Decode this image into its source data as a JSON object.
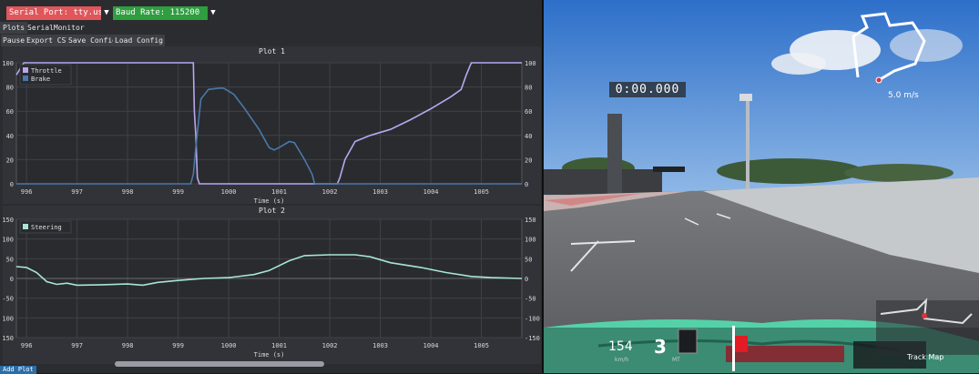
{
  "toolbar": {
    "serial_port_label": "Serial Port: tty.usbseria",
    "baud_rate_label": "Baud Rate: 115200",
    "tabs": [
      "Plots",
      "SerialMonitor"
    ],
    "buttons": [
      "Pause",
      "Export CSV",
      "Save Config",
      "Load Config"
    ],
    "add_plot": "Add Plot"
  },
  "colors": {
    "serial_port_bg": "#e0565b",
    "baud_rate_bg": "#2e9e3e",
    "throttle": "#b6a8f0",
    "brake": "#4a79a8",
    "steering": "#a8e6d2",
    "plot_bg": "#323338",
    "add_plot_bg": "#2a6fa8"
  },
  "chart_data": [
    {
      "type": "line",
      "title": "Plot 1",
      "xlabel": "Time (s)",
      "ylabel": "",
      "xlim": [
        995.8,
        1005.8
      ],
      "ylim": [
        0,
        100
      ],
      "x_ticks": [
        "996",
        "997",
        "998",
        "999",
        "1000",
        "1001",
        "1002",
        "1003",
        "1004",
        "1005"
      ],
      "y_ticks": [
        "0",
        "20",
        "40",
        "60",
        "80",
        "100"
      ],
      "legend_position": "top-left",
      "grid": true,
      "series": [
        {
          "name": "Throttle",
          "color_key": "throttle",
          "points": [
            [
              995.8,
              90
            ],
            [
              995.9,
              97
            ],
            [
              995.95,
              100
            ],
            [
              999.3,
              100
            ],
            [
              999.32,
              60
            ],
            [
              999.35,
              40
            ],
            [
              999.38,
              5
            ],
            [
              999.42,
              0
            ],
            [
              1002.15,
              0
            ],
            [
              1002.2,
              5
            ],
            [
              1002.3,
              20
            ],
            [
              1002.5,
              35
            ],
            [
              1002.8,
              40
            ],
            [
              1003.2,
              45
            ],
            [
              1003.6,
              53
            ],
            [
              1004.0,
              62
            ],
            [
              1004.4,
              72
            ],
            [
              1004.6,
              78
            ],
            [
              1004.7,
              90
            ],
            [
              1004.8,
              100
            ],
            [
              1005.8,
              100
            ]
          ]
        },
        {
          "name": "Brake",
          "color_key": "brake",
          "points": [
            [
              995.8,
              0
            ],
            [
              999.25,
              0
            ],
            [
              999.3,
              8
            ],
            [
              999.35,
              30
            ],
            [
              999.45,
              70
            ],
            [
              999.6,
              78
            ],
            [
              999.8,
              79
            ],
            [
              999.9,
              79
            ],
            [
              1000.1,
              74
            ],
            [
              1000.3,
              63
            ],
            [
              1000.6,
              45
            ],
            [
              1000.8,
              30
            ],
            [
              1000.9,
              28
            ],
            [
              1001.0,
              30
            ],
            [
              1001.2,
              35
            ],
            [
              1001.3,
              34
            ],
            [
              1001.5,
              20
            ],
            [
              1001.65,
              8
            ],
            [
              1001.7,
              0
            ],
            [
              1005.8,
              0
            ]
          ]
        }
      ]
    },
    {
      "type": "line",
      "title": "Plot 2",
      "xlabel": "Time (s)",
      "ylabel": "",
      "xlim": [
        995.8,
        1005.8
      ],
      "ylim": [
        -150,
        150
      ],
      "x_ticks": [
        "996",
        "997",
        "998",
        "999",
        "1000",
        "1001",
        "1002",
        "1003",
        "1004",
        "1005"
      ],
      "y_ticks": [
        "-150",
        "-100",
        "-50",
        "0",
        "50",
        "100",
        "150"
      ],
      "legend_position": "top-left",
      "grid": true,
      "series": [
        {
          "name": "Steering",
          "color_key": "steering",
          "points": [
            [
              995.8,
              30
            ],
            [
              996.0,
              28
            ],
            [
              996.2,
              15
            ],
            [
              996.4,
              -8
            ],
            [
              996.6,
              -15
            ],
            [
              996.8,
              -12
            ],
            [
              997.0,
              -17
            ],
            [
              997.5,
              -16
            ],
            [
              998.0,
              -14
            ],
            [
              998.3,
              -17
            ],
            [
              998.6,
              -10
            ],
            [
              999.0,
              -5
            ],
            [
              999.5,
              0
            ],
            [
              1000.0,
              2
            ],
            [
              1000.5,
              10
            ],
            [
              1000.8,
              20
            ],
            [
              1001.2,
              45
            ],
            [
              1001.5,
              58
            ],
            [
              1002.0,
              60
            ],
            [
              1002.5,
              60
            ],
            [
              1002.8,
              55
            ],
            [
              1003.2,
              40
            ],
            [
              1003.8,
              28
            ],
            [
              1004.3,
              15
            ],
            [
              1004.8,
              5
            ],
            [
              1005.2,
              2
            ],
            [
              1005.8,
              0
            ]
          ]
        }
      ]
    }
  ],
  "game": {
    "lap_timer": "0:00.000",
    "speed_ms": "5.0",
    "speed_ms_unit": "m/s",
    "speed_kmh": "154",
    "speed_unit": "km/h",
    "gear": "3",
    "transmission": "MT",
    "track_map_label": "Track Map"
  }
}
